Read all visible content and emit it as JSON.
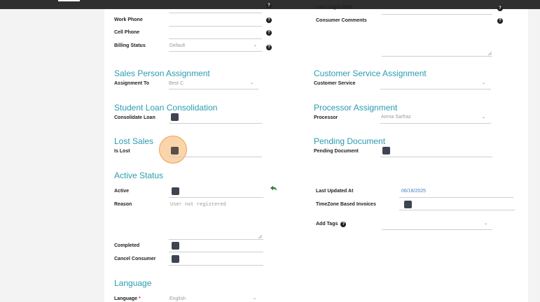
{
  "left": {
    "work_phone": "Work Phone",
    "cell_phone": "Cell Phone",
    "billing_status": "Billing Status",
    "billing_status_value": "Default",
    "sales_person_title": "Sales Person Assignment",
    "assignment_to": "Assignment To",
    "assignment_to_value": "Best C",
    "student_loan_title": "Student Loan Consolidation",
    "consolidate_loan": "Consolidate Loan",
    "lost_sales_title": "Lost Sales",
    "is_lost": "Is Lost",
    "active_status_title": "Active Status",
    "active": "Active",
    "reason": "Reason",
    "reason_value": "User not registered",
    "completed": "Completed",
    "cancel_consumer": "Cancel Consumer",
    "language_title": "Language",
    "language": "Language",
    "language_required": "*",
    "language_value": "English"
  },
  "right": {
    "last_login_date": "Last Login Date",
    "consumer_comments": "Consumer Comments",
    "customer_service_title": "Customer Service Assignment",
    "customer_service": "Customer Service",
    "processor_title": "Processor Assignment",
    "processor": "Processor",
    "processor_value": "Amna Sarfraz",
    "pending_document_title": "Pending Document",
    "pending_document": "Pending Document",
    "last_updated_at": "Last Updated At",
    "last_updated_value": "06/18/2025",
    "timezone_invoices": "TimeZone Based Invoices",
    "add_tags": "Add Tags"
  },
  "icons": {
    "help": "question-circle-icon",
    "chevron": "chevron-down-icon",
    "undo": "undo-arrow-icon"
  },
  "colors": {
    "section_title": "#2a9cb0",
    "checkbox": "#3e4452",
    "highlight": "#f6b266",
    "undo": "#2e7d32"
  }
}
